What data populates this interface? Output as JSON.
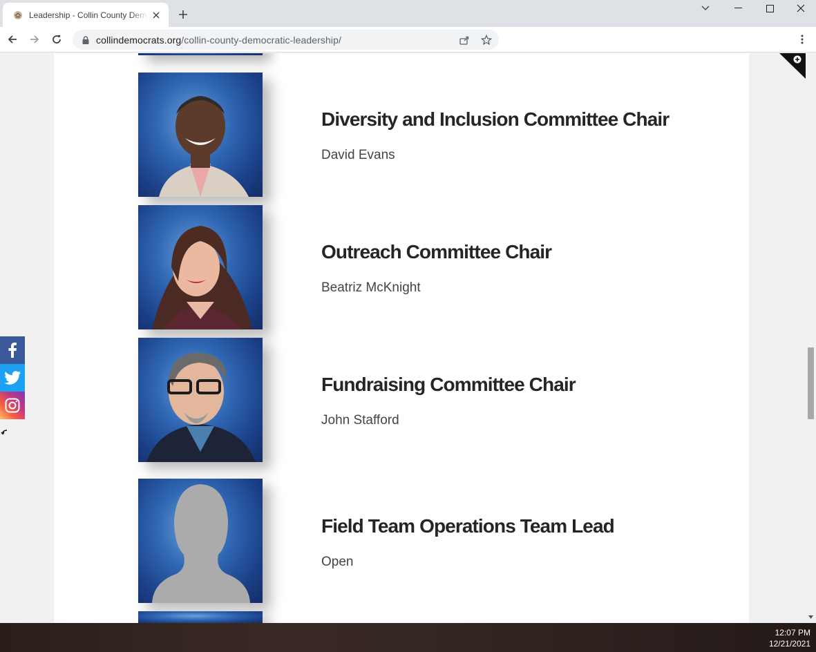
{
  "browser": {
    "tab_title": "Leadership - Collin County Democratic Party",
    "url_domain": "collindemocrats.org",
    "url_path": "/collin-county-democratic-leadership/"
  },
  "leaders": [
    {
      "title": "Diversity and Inclusion Committee Chair",
      "name": "David Evans"
    },
    {
      "title": "Outreach Committee Chair",
      "name": "Beatriz McKnight"
    },
    {
      "title": "Fundraising Committee Chair",
      "name": "John Stafford"
    },
    {
      "title": "Field Team Operations Team Lead",
      "name": "Open"
    }
  ],
  "social": [
    {
      "network": "Facebook",
      "icon": "facebook-icon",
      "color": "#3b5998"
    },
    {
      "network": "Twitter",
      "icon": "twitter-icon",
      "color": "#1da1f2"
    },
    {
      "network": "Instagram",
      "icon": "instagram-icon",
      "color": "#c13584"
    }
  ],
  "taskbar": {
    "time": "12:07 PM",
    "date": "12/21/2021"
  }
}
